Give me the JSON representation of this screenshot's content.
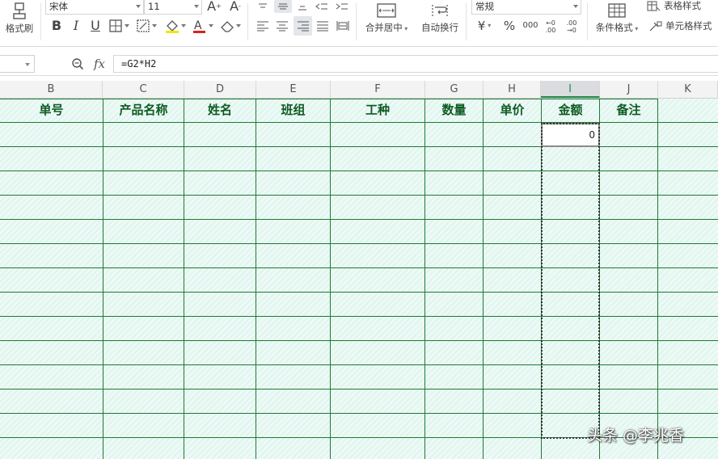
{
  "ribbon": {
    "format_painter_label": "格式刷",
    "font_name": "宋体",
    "font_size": "11",
    "font_grow_label": "A",
    "font_shrink_label": "A",
    "bold_label": "B",
    "italic_label": "I",
    "underline_label": "U",
    "font_color_label": "A",
    "merge_center_label": "合并居中",
    "wrap_text_label": "自动换行",
    "number_format": "常规",
    "currency_label": "¥",
    "percent_label": "%",
    "thousands_label": "000",
    "increase_decimal_label": "←0 .00",
    "decrease_decimal_label": ".00 →0",
    "conditional_format_label": "条件格式",
    "table_style_label": "表格样式",
    "cell_style_label": "单元格样式",
    "accent_color": "#1e8a4c",
    "font_color_bar": "#d9231c",
    "fill_color_bar": "#f2e600"
  },
  "formula_bar": {
    "name_box": "",
    "fx_label": "fx",
    "formula": "=G2*H2"
  },
  "columns": [
    "B",
    "C",
    "D",
    "E",
    "F",
    "G",
    "H",
    "I",
    "J",
    "K"
  ],
  "active_column": "I",
  "header_row": [
    "单号",
    "产品名称",
    "姓名",
    "班组",
    "工种",
    "数量",
    "单价",
    "金额",
    "备注"
  ],
  "cells": {
    "I2": "0"
  },
  "grid_colors": {
    "border": "#1f7a34",
    "fill": "#ecfaf6",
    "header_text": "#0e5a22"
  },
  "watermark": "头条 @李兆香"
}
